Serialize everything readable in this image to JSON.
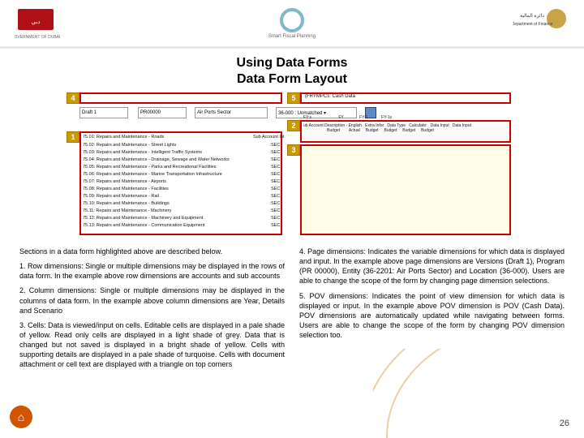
{
  "header": {
    "left_alt": "Government of Dubai",
    "center_caption": "Smart Fiscal Planning",
    "right_alt": "Department of Finance"
  },
  "title_line1": "Using Data Forms",
  "title_line2": "Data Form Layout",
  "callouts": {
    "c1": "1",
    "c2": "2",
    "c3": "3",
    "c4": "4",
    "c5": "5"
  },
  "form": {
    "pov_left": "(FRYMPCs: Cash Data",
    "pov_right": "36-000 : Unmatched ▾",
    "pov_mid": "Air Ports Sector",
    "drop1": "Draft 1",
    "drop2": "PR00000",
    "col_hdr": "ub Account Description - English   Extra Infor   Data Type   Calculate:   Data Input   Data Input\n                     Budget        Actual     Budget     Budget     Budget     Budget",
    "fy_labels": "FY:s                        FY              FY-1            FY-1s",
    "rows": [
      "75.01: Repairs and Maintenance - Roads",
      "75.02: Repairs and Maintenance - Street Lights",
      "75.03: Repairs and Maintenance - Intelligent Traffic Systems",
      "75.04: Repairs and Maintenance - Drainage, Sewage and Water Networks",
      "75.05: Repairs and Maintenance - Parks and Recreational Facilities",
      "75.06: Repairs and Maintenance - Marine Transportation Infrastructure",
      "75.07: Repairs and Maintenance - Airports",
      "75.08: Repairs and Maintenance - Facilities",
      "75.09: Repairs and Maintenance - Rail",
      "75.10: Repairs and Maintenance - Buildings",
      "75.11: Repairs and Maintenance - Machinery",
      "75.12: Repairs and Maintenance - Machinery and Equipment",
      "75.13: Repairs and Maintenance - Communication Equipment"
    ],
    "vals": [
      "Sub Account Int",
      "SEC",
      "SEC",
      "SEC",
      "SEC",
      "SEC",
      "SEC",
      "SEC",
      "SEC",
      "SEC",
      "SEC",
      "SEC",
      "SEC"
    ]
  },
  "left_col": {
    "intro": "Sections in a data form highlighted above are described below.",
    "p1": "1. Row dimensions: Single or multiple dimensions may be displayed in the rows of data form. In the example above row dimensions are accounts and sub accounts",
    "p2": "2. Column dimensions: Single or multiple dimensions may be displayed in the columns of data form. In the example above column dimensions are Year, Details and Scenario",
    "p3": "3. Cells: Data is viewed/input on cells. Editable cells are displayed in a pale shade of yellow. Read only cells are displayed in a light shade of grey. Data that is changed but not saved is displayed in a bright shade of yellow. Cells with supporting details are displayed in a pale shade of turquoise. Cells with document attachment or cell text are displayed with a triangle on top corners"
  },
  "right_col": {
    "p4": "4. Page dimensions: Indicates the variable dimensions for which data is displayed and input. In the example above page dimensions are Versions (Draft 1), Program (PR 00000), Entity (36-2201: Air Ports Sector) and Location (36-000). Users are able to change the scope of the form by changing page dimension selections.",
    "p5": "5. POV dimensions: Indicates the point of view dimension for which data is displayed or input. In the example above POV dimension is POV (Cash Data). POV dimensions are automatically updated while navigating between forms. Users are able to change the scope of the form by changing POV dimension selection too."
  },
  "page_number": "26"
}
